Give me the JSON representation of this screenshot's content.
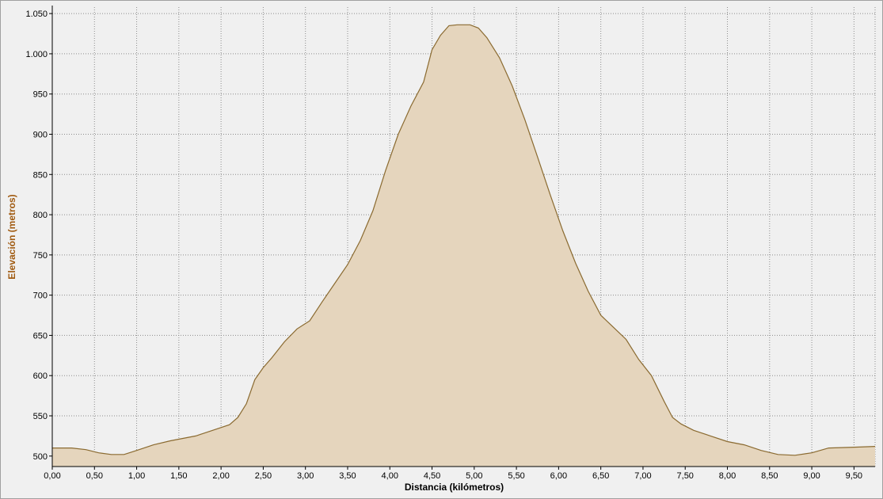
{
  "chart_data": {
    "type": "area",
    "xlabel": "Distancia (kilómetros)",
    "ylabel": "Elevación (metros)",
    "xlim": [
      0,
      9.75
    ],
    "ylim": [
      487,
      1058
    ],
    "grid": true,
    "colors": {
      "fill": "#e5d5bd",
      "line": "#8a6a30",
      "axis_title": "#a05a10",
      "grid": "#8c8c8c"
    },
    "x_ticks": [
      0,
      0.5,
      1,
      1.5,
      2,
      2.5,
      3,
      3.5,
      4,
      4.5,
      5,
      5.5,
      6,
      6.5,
      7,
      7.5,
      8,
      8.5,
      9,
      9.5
    ],
    "x_tick_labels": [
      "0,00",
      "0,50",
      "1,00",
      "1,50",
      "2,00",
      "2,50",
      "3,00",
      "3,50",
      "4,00",
      "4,50",
      "5,00",
      "5,50",
      "6,00",
      "6,50",
      "7,00",
      "7,50",
      "8,00",
      "8,50",
      "9,00",
      "9,50"
    ],
    "y_ticks": [
      500,
      550,
      600,
      650,
      700,
      750,
      800,
      850,
      900,
      950,
      1000,
      1050
    ],
    "y_tick_labels": [
      "500",
      "550",
      "600",
      "650",
      "700",
      "750",
      "800",
      "850",
      "900",
      "950",
      "1.000",
      "1.050"
    ],
    "series": [
      {
        "x": [
          0,
          0.23,
          0.4,
          0.55,
          0.7,
          0.85,
          1.0,
          1.2,
          1.4,
          1.7,
          1.9,
          2.1,
          2.2,
          2.3,
          2.4,
          2.5,
          2.6,
          2.75,
          2.9,
          3.05,
          3.2,
          3.35,
          3.5,
          3.65,
          3.8,
          3.95,
          4.1,
          4.25,
          4.4,
          4.5,
          4.6,
          4.7,
          4.8,
          4.95,
          5.05,
          5.15,
          5.3,
          5.45,
          5.6,
          5.75,
          5.9,
          6.05,
          6.2,
          6.35,
          6.5,
          6.65,
          6.8,
          6.95,
          7.1,
          7.25,
          7.35,
          7.45,
          7.6,
          7.8,
          8.0,
          8.2,
          8.4,
          8.6,
          8.8,
          9.0,
          9.2,
          9.5,
          9.75
        ],
        "y": [
          510,
          510,
          508,
          504,
          502,
          502,
          507,
          514,
          519,
          525,
          532,
          539,
          548,
          565,
          595,
          610,
          622,
          642,
          658,
          668,
          692,
          715,
          738,
          768,
          805,
          855,
          900,
          935,
          965,
          1005,
          1023,
          1035,
          1036,
          1036,
          1032,
          1020,
          995,
          960,
          918,
          872,
          825,
          780,
          740,
          705,
          675,
          660,
          645,
          620,
          600,
          568,
          548,
          540,
          532,
          525,
          518,
          514,
          507,
          502,
          501,
          504,
          510,
          511,
          512
        ]
      }
    ]
  }
}
